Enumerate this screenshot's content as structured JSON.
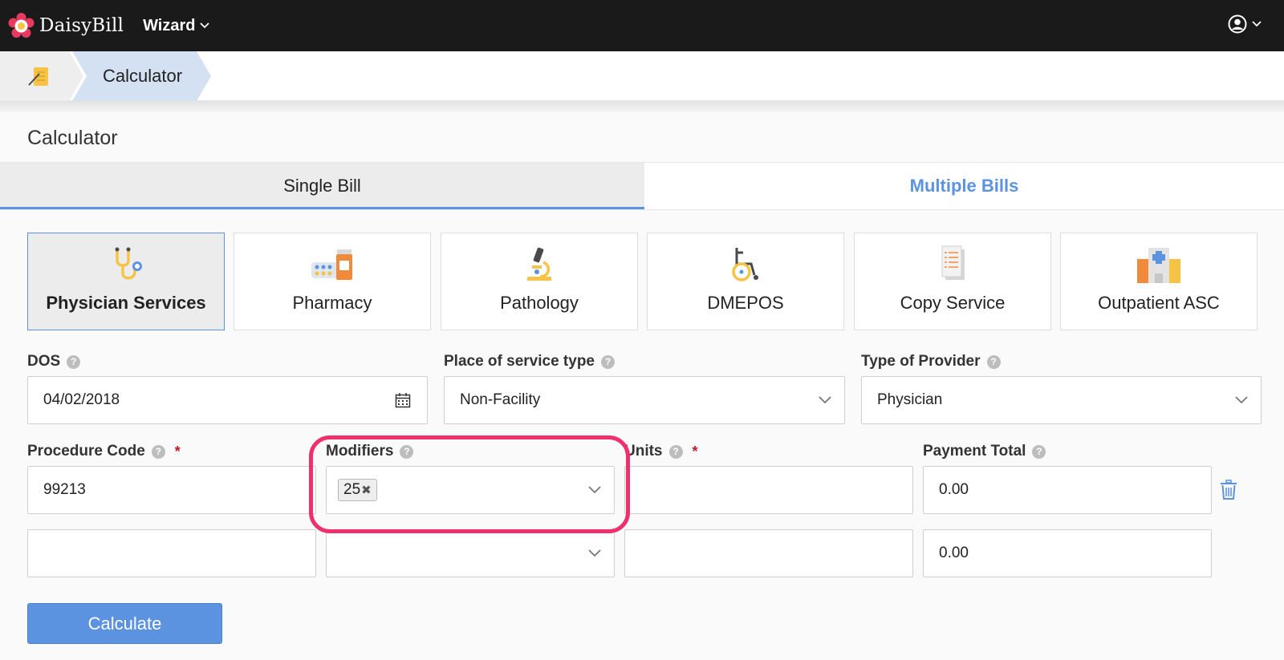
{
  "topbar": {
    "brand": "DaisyBill",
    "menu_label": "Wizard",
    "user_icon": "user-circle-icon"
  },
  "breadcrumb": {
    "home_icon": "notepad-icon",
    "current": "Calculator"
  },
  "page": {
    "title": "Calculator"
  },
  "tabs": [
    {
      "label": "Single Bill",
      "active": true
    },
    {
      "label": "Multiple Bills",
      "active": false
    }
  ],
  "services": [
    {
      "label": "Physician Services",
      "icon": "stethoscope-icon",
      "active": true
    },
    {
      "label": "Pharmacy",
      "icon": "pills-icon",
      "active": false
    },
    {
      "label": "Pathology",
      "icon": "microscope-icon",
      "active": false
    },
    {
      "label": "DMEPOS",
      "icon": "wheelchair-icon",
      "active": false
    },
    {
      "label": "Copy Service",
      "icon": "document-copy-icon",
      "active": false
    },
    {
      "label": "Outpatient ASC",
      "icon": "hospital-icon",
      "active": false
    }
  ],
  "form": {
    "dos": {
      "label": "DOS",
      "value": "04/02/2018"
    },
    "place_of_service": {
      "label": "Place of service type",
      "value": "Non-Facility"
    },
    "provider_type": {
      "label": "Type of Provider",
      "value": "Physician"
    },
    "procedure_code": {
      "label": "Procedure Code",
      "required_mark": "*"
    },
    "modifiers": {
      "label": "Modifiers"
    },
    "units": {
      "label": "Units",
      "required_mark": "*"
    },
    "payment_total": {
      "label": "Payment Total"
    },
    "rows": [
      {
        "procedure_code": "99213",
        "modifier_tags": [
          "25"
        ],
        "units": "",
        "payment_total": "0.00"
      },
      {
        "procedure_code": "",
        "modifier_tags": [],
        "units": "",
        "payment_total": "0.00"
      }
    ],
    "tag_remove_glyph": "✖"
  },
  "actions": {
    "calculate": "Calculate"
  },
  "colors": {
    "accent": "#5b93e0",
    "highlight": "#f0306c",
    "topbar": "#1a1a1a"
  }
}
